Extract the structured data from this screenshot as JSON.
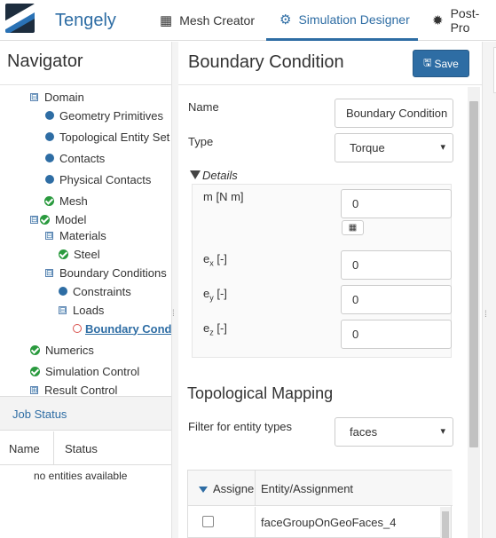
{
  "app": {
    "brand": "Tengely",
    "tabs": [
      {
        "label": "Mesh Creator",
        "icon": "grid-icon"
      },
      {
        "label": "Simulation Designer",
        "icon": "gears-icon"
      },
      {
        "label": "Post-Pro",
        "icon": "gear-icon"
      }
    ],
    "active_tab": "Simulation Designer",
    "accent_color": "#2e6da4"
  },
  "navigator": {
    "title": "Navigator",
    "items": [
      {
        "label": "Domain",
        "marker": "toggle",
        "toggle": "⊟"
      },
      {
        "label": "Geometry Primitives",
        "marker": "dot"
      },
      {
        "label": "Topological Entity Set",
        "marker": "dot"
      },
      {
        "label": "Contacts",
        "marker": "dot"
      },
      {
        "label": "Physical Contacts",
        "marker": "dot"
      },
      {
        "label": "Mesh",
        "marker": "check"
      },
      {
        "label": "Model",
        "marker": "toggle+check",
        "toggle": "⊟"
      },
      {
        "label": "Materials",
        "marker": "toggle",
        "toggle": "⊟"
      },
      {
        "label": "Steel",
        "marker": "check"
      },
      {
        "label": "Boundary Conditions",
        "marker": "toggle",
        "toggle": "⊟"
      },
      {
        "label": "Constraints",
        "marker": "dot"
      },
      {
        "label": "Loads",
        "marker": "toggle",
        "toggle": "⊟"
      },
      {
        "label": "Boundary Cond",
        "marker": "ring",
        "selected": true
      },
      {
        "label": "Numerics",
        "marker": "check"
      },
      {
        "label": "Simulation Control",
        "marker": "check"
      },
      {
        "label": "Result Control",
        "marker": "toggle",
        "toggle": "⊞"
      }
    ]
  },
  "job_status": {
    "title": "Job Status",
    "columns": [
      "Name",
      "Status"
    ],
    "empty_text": "no entities available"
  },
  "form": {
    "title": "Boundary Condition",
    "save_label": "Save",
    "name_label": "Name",
    "name_value": "Boundary Condition",
    "type_label": "Type",
    "type_value": "Torque",
    "details_label": "Details",
    "fields": [
      {
        "label_main": "m",
        "label_sub": "",
        "label_unit": " [N m]",
        "value": "0"
      },
      {
        "label_main": "e",
        "label_sub": "x",
        "label_unit": " [-]",
        "value": "0"
      },
      {
        "label_main": "e",
        "label_sub": "y",
        "label_unit": " [-]",
        "value": "0"
      },
      {
        "label_main": "e",
        "label_sub": "z",
        "label_unit": " [-]",
        "value": "0"
      }
    ],
    "table_icon": "table-icon",
    "mapping_title": "Topological Mapping",
    "filter_label": "Filter for entity types",
    "filter_value": "faces",
    "grid_columns": [
      "Assigne",
      "Entity/Assignment"
    ],
    "grid_rows": [
      {
        "checked": false,
        "entity": "faceGroupOnGeoFaces_4"
      }
    ]
  }
}
